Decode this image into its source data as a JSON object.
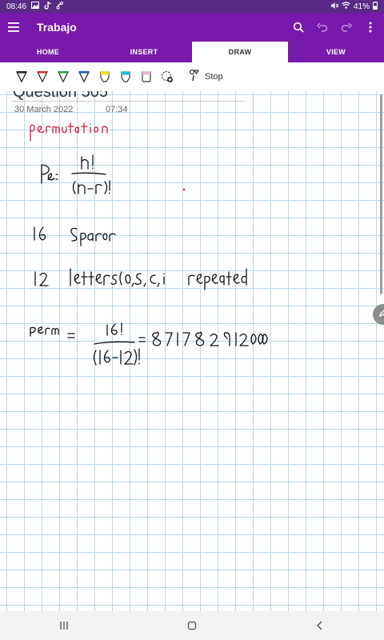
{
  "status_bar": {
    "time": "08:46",
    "battery": "41%"
  },
  "app_bar": {
    "title": "Trabajo"
  },
  "tabs": [
    {
      "label": "HOME"
    },
    {
      "label": "INSERT"
    },
    {
      "label": "DRAW"
    },
    {
      "label": "VIEW"
    }
  ],
  "toolbar": {
    "pens": [
      {
        "icon": "pen-black-icon",
        "color": "#222222"
      },
      {
        "icon": "pen-red-icon",
        "color": "#d32b2b"
      },
      {
        "icon": "pen-green-icon",
        "color": "#2f9e44"
      },
      {
        "icon": "pen-blue-icon",
        "color": "#1e5aa8"
      },
      {
        "icon": "highlighter-yellow-icon",
        "color": "#f2e41e"
      },
      {
        "icon": "highlighter-teal-icon",
        "color": "#19c2c9"
      },
      {
        "icon": "highlighter-pink-icon",
        "color": "#e7b7d6"
      }
    ],
    "stop_label": "Stop"
  },
  "page": {
    "title": "Question 505",
    "date": "30 March 2022",
    "time": "07:34"
  },
  "colors": {
    "accent": "#7719aa",
    "grid": "#b6d9ee",
    "ink": "#111111",
    "red_ink": "#d41a3a"
  }
}
